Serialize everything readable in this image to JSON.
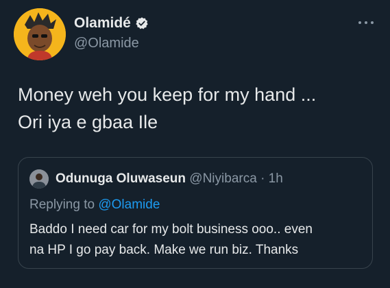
{
  "tweet": {
    "author": {
      "name": "Olamidé",
      "handle": "@Olamide",
      "verified": true,
      "avatar_icon": "cartoon-avatar-icon"
    },
    "more_icon": "more-horizontal-icon",
    "text_lines": [
      "Money weh you keep for my hand ...",
      "Ori iya e gbaa Ile"
    ]
  },
  "quote": {
    "author": {
      "name": "Odunuga Oluwaseun",
      "handle": "@Niyibarca",
      "separator": "·",
      "time": "1h",
      "avatar_icon": "user-avatar-icon"
    },
    "replying_prefix": "Replying to",
    "replying_to": "@Olamide",
    "text_lines": [
      "Baddo I need car for my bolt business ooo.. even",
      "na HP I go pay back. Make we run biz. Thanks"
    ]
  },
  "colors": {
    "background": "#15202b",
    "text": "#e7e9ea",
    "secondary": "#8b98a5",
    "accent": "#1d9bf0",
    "border": "#38444d",
    "avatar_bg": "#f5b51c"
  }
}
